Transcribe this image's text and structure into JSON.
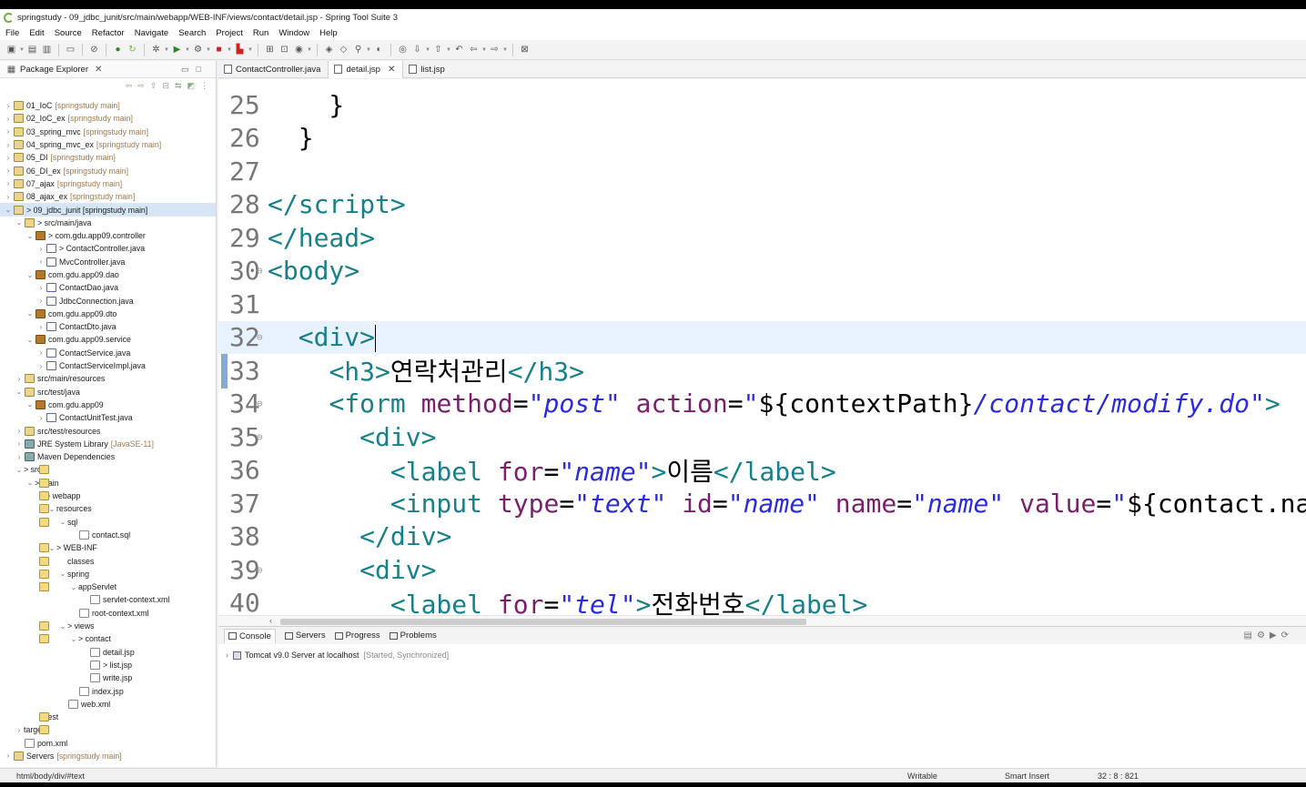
{
  "window": {
    "title": "springstudy - 09_jdbc_junit/src/main/webapp/WEB-INF/views/contact/detail.jsp - Spring Tool Suite 3"
  },
  "menu": [
    "File",
    "Edit",
    "Source",
    "Refactor",
    "Navigate",
    "Search",
    "Project",
    "Run",
    "Window",
    "Help"
  ],
  "explorer": {
    "title": "Package Explorer",
    "rows": [
      {
        "tw": ">",
        "icon": "proj",
        "label": "01_IoC",
        "deco": "[springstudy main]",
        "indent": 0
      },
      {
        "tw": ">",
        "icon": "proj",
        "label": "02_IoC_ex",
        "deco": "[springstudy main]",
        "indent": 0
      },
      {
        "tw": ">",
        "icon": "proj",
        "label": "03_spring_mvc",
        "deco": "[springstudy main]",
        "indent": 0
      },
      {
        "tw": ">",
        "icon": "proj",
        "label": "04_spring_mvc_ex",
        "deco": "[springstudy main]",
        "indent": 0
      },
      {
        "tw": ">",
        "icon": "proj",
        "label": "05_DI",
        "deco": "[springstudy main]",
        "indent": 0
      },
      {
        "tw": ">",
        "icon": "proj",
        "label": "06_DI_ex",
        "deco": "[springstudy main]",
        "indent": 0
      },
      {
        "tw": ">",
        "icon": "proj",
        "label": "07_ajax",
        "deco": "[springstudy main]",
        "indent": 0
      },
      {
        "tw": ">",
        "icon": "proj",
        "label": "08_ajax_ex",
        "deco": "[springstudy main]",
        "indent": 0
      },
      {
        "tw": "v",
        "icon": "proj",
        "label": "> 09_jdbc_junit [springstudy main]",
        "deco": "",
        "indent": 0,
        "sel": true
      },
      {
        "tw": "v",
        "icon": "src",
        "label": "> src/main/java",
        "deco": "",
        "indent": 1
      },
      {
        "tw": "v",
        "icon": "pkgi",
        "label": "> com.gdu.app09.controller",
        "deco": "",
        "indent": 2
      },
      {
        "tw": ">",
        "icon": "java",
        "label": "> ContactController.java",
        "deco": "",
        "indent": 3
      },
      {
        "tw": ">",
        "icon": "java",
        "label": "MvcController.java",
        "deco": "",
        "indent": 3
      },
      {
        "tw": "v",
        "icon": "pkgi",
        "label": "com.gdu.app09.dao",
        "deco": "",
        "indent": 2
      },
      {
        "tw": ">",
        "icon": "java",
        "label": "ContactDao.java",
        "deco": "",
        "indent": 3
      },
      {
        "tw": ">",
        "icon": "java",
        "label": "JdbcConnection.java",
        "deco": "",
        "indent": 3
      },
      {
        "tw": "v",
        "icon": "pkgi",
        "label": "com.gdu.app09.dto",
        "deco": "",
        "indent": 2
      },
      {
        "tw": ">",
        "icon": "java",
        "label": "ContactDto.java",
        "deco": "",
        "indent": 3
      },
      {
        "tw": "v",
        "icon": "pkgi",
        "label": "com.gdu.app09.service",
        "deco": "",
        "indent": 2
      },
      {
        "tw": ">",
        "icon": "java",
        "label": "ContactService.java",
        "deco": "",
        "indent": 3
      },
      {
        "tw": ">",
        "icon": "java",
        "label": "ContactServiceImpl.java",
        "deco": "",
        "indent": 3
      },
      {
        "tw": ">",
        "icon": "src",
        "label": "src/main/resources",
        "deco": "",
        "indent": 1
      },
      {
        "tw": "v",
        "icon": "src",
        "label": "src/test/java",
        "deco": "",
        "indent": 1
      },
      {
        "tw": "v",
        "icon": "pkgi",
        "label": "com.gdu.app09",
        "deco": "",
        "indent": 2
      },
      {
        "tw": ">",
        "icon": "java",
        "label": "ContactUnitTest.java",
        "deco": "",
        "indent": 3
      },
      {
        "tw": ">",
        "icon": "src",
        "label": "src/test/resources",
        "deco": "",
        "indent": 1
      },
      {
        "tw": ">",
        "icon": "lib",
        "label": "JRE System Library",
        "deco": "[JavaSE-11]",
        "indent": 1
      },
      {
        "tw": ">",
        "icon": "lib",
        "label": "Maven Dependencies",
        "deco": "",
        "indent": 1
      },
      {
        "tw": "v",
        "icon": "fold",
        "label": "> src",
        "deco": "",
        "indent": 1
      },
      {
        "tw": "v",
        "icon": "fold",
        "label": "> main",
        "deco": "",
        "indent": 2
      },
      {
        "tw": "v",
        "icon": "fold",
        "label": "> webapp",
        "deco": "",
        "indent": 3
      },
      {
        "tw": "v",
        "icon": "fold",
        "label": "resources",
        "deco": "",
        "indent": 4
      },
      {
        "tw": "v",
        "icon": "fold",
        "label": "sql",
        "deco": "",
        "indent": 5
      },
      {
        "tw": "",
        "icon": "file",
        "label": "contact.sql",
        "deco": "",
        "indent": 6
      },
      {
        "tw": "v",
        "icon": "fold",
        "label": "> WEB-INF",
        "deco": "",
        "indent": 4
      },
      {
        "tw": "",
        "icon": "fold",
        "label": "classes",
        "deco": "",
        "indent": 5
      },
      {
        "tw": "v",
        "icon": "fold",
        "label": "spring",
        "deco": "",
        "indent": 5
      },
      {
        "tw": "v",
        "icon": "fold",
        "label": "appServlet",
        "deco": "",
        "indent": 6
      },
      {
        "tw": "",
        "icon": "file",
        "label": "servlet-context.xml",
        "deco": "",
        "indent": 7
      },
      {
        "tw": "",
        "icon": "file",
        "label": "root-context.xml",
        "deco": "",
        "indent": 6
      },
      {
        "tw": "v",
        "icon": "fold",
        "label": "> views",
        "deco": "",
        "indent": 5
      },
      {
        "tw": "v",
        "icon": "fold",
        "label": "> contact",
        "deco": "",
        "indent": 6
      },
      {
        "tw": "",
        "icon": "file",
        "label": "detail.jsp",
        "deco": "",
        "indent": 7
      },
      {
        "tw": "",
        "icon": "file",
        "label": "> list.jsp",
        "deco": "",
        "indent": 7
      },
      {
        "tw": "",
        "icon": "file",
        "label": "write.jsp",
        "deco": "",
        "indent": 7
      },
      {
        "tw": "",
        "icon": "file",
        "label": "index.jsp",
        "deco": "",
        "indent": 6
      },
      {
        "tw": "",
        "icon": "file",
        "label": "web.xml",
        "deco": "",
        "indent": 5
      },
      {
        "tw": "",
        "icon": "fold",
        "label": "test",
        "deco": "",
        "indent": 3
      },
      {
        "tw": ">",
        "icon": "fold",
        "label": "target",
        "deco": "",
        "indent": 1
      },
      {
        "tw": "",
        "icon": "file",
        "label": "pom.xml",
        "deco": "",
        "indent": 1
      },
      {
        "tw": ">",
        "icon": "proj",
        "label": "Servers",
        "deco": "[springstudy main]",
        "indent": 0
      }
    ]
  },
  "editor_tabs": [
    {
      "label": "ContactController.java",
      "active": false
    },
    {
      "label": "detail.jsp",
      "active": true
    },
    {
      "label": "list.jsp",
      "active": false
    }
  ],
  "code_lines": [
    {
      "n": "25",
      "fold": "",
      "html": "<span class='txt'>    }</span>"
    },
    {
      "n": "26",
      "fold": "",
      "html": "<span class='txt'>  }</span>"
    },
    {
      "n": "27",
      "fold": "",
      "html": ""
    },
    {
      "n": "28",
      "fold": "",
      "html": "<span class='tag'>&lt;/script&gt;</span>"
    },
    {
      "n": "29",
      "fold": "",
      "html": "<span class='tag'>&lt;/head&gt;</span>"
    },
    {
      "n": "30",
      "fold": "⊖",
      "html": "<span class='tag'>&lt;body&gt;</span>"
    },
    {
      "n": "31",
      "fold": "",
      "html": ""
    },
    {
      "n": "32",
      "fold": "⊖",
      "html": "  <span class='tag'>&lt;div&gt;</span><span class='caret'></span>",
      "cur": true
    },
    {
      "n": "33",
      "fold": "",
      "html": "    <span class='tag'>&lt;h3&gt;</span><span class='txt'>연락처관리</span><span class='tag'>&lt;/h3&gt;</span>"
    },
    {
      "n": "34",
      "fold": "⊖",
      "html": "    <span class='tag'>&lt;form</span> <span class='attr'>method</span>=<span class='val'>\"post\"</span> <span class='attr'>action</span>=<span class='val'>\"</span><span class='txt'>${contextPath}</span><span class='val'>/contact/modify.do\"</span><span class='tag'>&gt;</span>"
    },
    {
      "n": "35",
      "fold": "⊖",
      "html": "      <span class='tag'>&lt;div&gt;</span>"
    },
    {
      "n": "36",
      "fold": "",
      "html": "        <span class='tag'>&lt;label</span> <span class='attr'>for</span>=<span class='val'>\"name\"</span><span class='tag'>&gt;</span><span class='txt'>이름</span><span class='tag'>&lt;/label&gt;</span>"
    },
    {
      "n": "37",
      "fold": "",
      "html": "        <span class='tag'>&lt;input</span> <span class='attr'>type</span>=<span class='val'>\"text\"</span> <span class='attr'>id</span>=<span class='val'>\"name\"</span> <span class='attr'>name</span>=<span class='val'>\"name\"</span> <span class='attr'>value</span>=<span class='val'>\"</span><span class='txt'>${contact.name}</span><span class='val'>\"</span>"
    },
    {
      "n": "38",
      "fold": "",
      "html": "      <span class='tag'>&lt;/div&gt;</span>"
    },
    {
      "n": "39",
      "fold": "⊖",
      "html": "      <span class='tag'>&lt;div&gt;</span>"
    },
    {
      "n": "40",
      "fold": "",
      "html": "        <span class='tag'>&lt;label</span> <span class='attr'>for</span>=<span class='val'>\"tel\"</span><span class='tag'>&gt;</span><span class='txt'>전화번호</span><span class='tag'>&lt;/label&gt;</span>"
    }
  ],
  "console": {
    "tabs": [
      "Console",
      "Servers",
      "Progress",
      "Problems"
    ],
    "server": "Tomcat v9.0 Server at localhost",
    "server_status": "[Started, Synchronized]"
  },
  "status": {
    "path": "html/body/div/#text",
    "writable": "Writable",
    "insert": "Smart Insert",
    "position": "32 : 8 : 821"
  }
}
